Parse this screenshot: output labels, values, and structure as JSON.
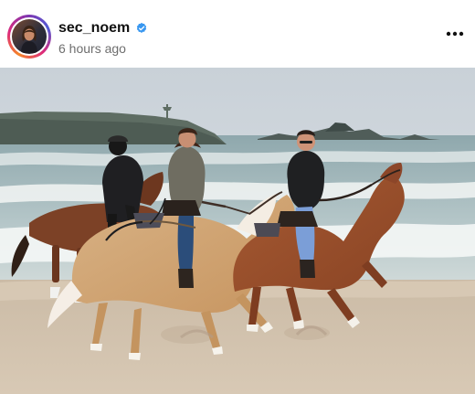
{
  "post": {
    "username": "sec_noem",
    "timestamp": "6 hours ago"
  },
  "icons": {
    "verified": "verified-badge-icon",
    "more": "more-options-icon"
  },
  "colors": {
    "username_text": "#111111",
    "timestamp_text": "#6e6e6e",
    "verified_blue": "#3897f0",
    "story_ring": "#dd2a7b"
  }
}
